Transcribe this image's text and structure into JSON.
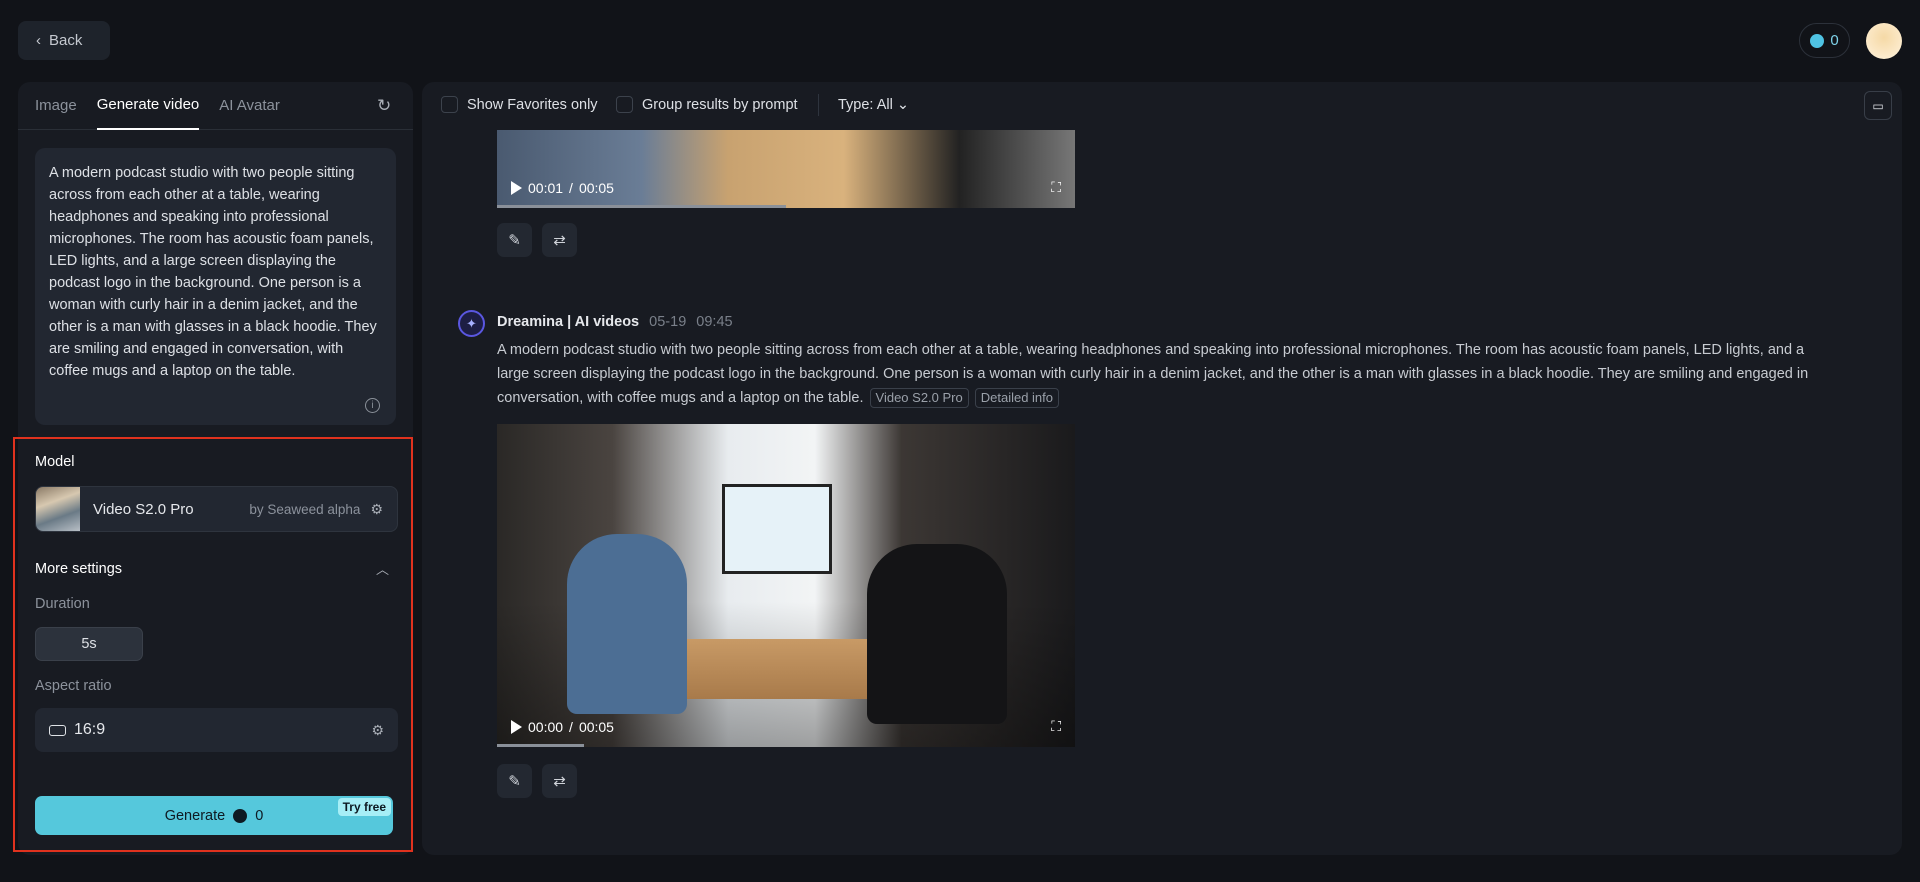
{
  "header": {
    "back_label": "Back",
    "credits": "0"
  },
  "left": {
    "tabs": [
      {
        "label": "Image"
      },
      {
        "label": "Generate video"
      },
      {
        "label": "AI Avatar"
      }
    ],
    "prompt": "A modern podcast studio with two people sitting across from each other at a table, wearing headphones and speaking into professional microphones. The room has acoustic foam panels, LED lights, and a large screen displaying the podcast logo in the background. One person is a woman with curly hair in a denim jacket, and the other is a man with glasses in a black hoodie. They are smiling and engaged in conversation, with coffee mugs and a laptop on the table.",
    "model_label": "Model",
    "model_name": "Video S2.0 Pro",
    "model_by": "by Seaweed alpha",
    "more_settings": "More settings",
    "duration_label": "Duration",
    "duration_value": "5s",
    "aspect_label": "Aspect ratio",
    "aspect_value": "16:9",
    "generate_label": "Generate",
    "generate_cost": "0",
    "try_free": "Try free"
  },
  "toolbar": {
    "favorites": "Show Favorites only",
    "group": "Group results by prompt",
    "type": "Type: All"
  },
  "results": [
    {
      "time": "00:01",
      "duration": "00:05",
      "progress": 0.5
    },
    {
      "author": "Dreamina | AI videos",
      "date": "05-19",
      "clock": "09:45",
      "prompt": "A modern podcast studio with two people sitting across from each other at a table, wearing headphones and speaking into professional microphones. The room has acoustic foam panels, LED lights, and a large screen displaying the podcast logo in the background. One person is a woman with curly hair in a denim jacket, and the other is a man with glasses in a black hoodie. They are smiling and engaged in conversation, with coffee mugs and a laptop on the table.",
      "tags": [
        "Video S2.0 Pro",
        "Detailed info"
      ],
      "time": "00:00",
      "duration": "00:05",
      "progress": 0.15
    }
  ],
  "colors": {
    "accent": "#55c8dc",
    "highlight": "#e0321e"
  }
}
